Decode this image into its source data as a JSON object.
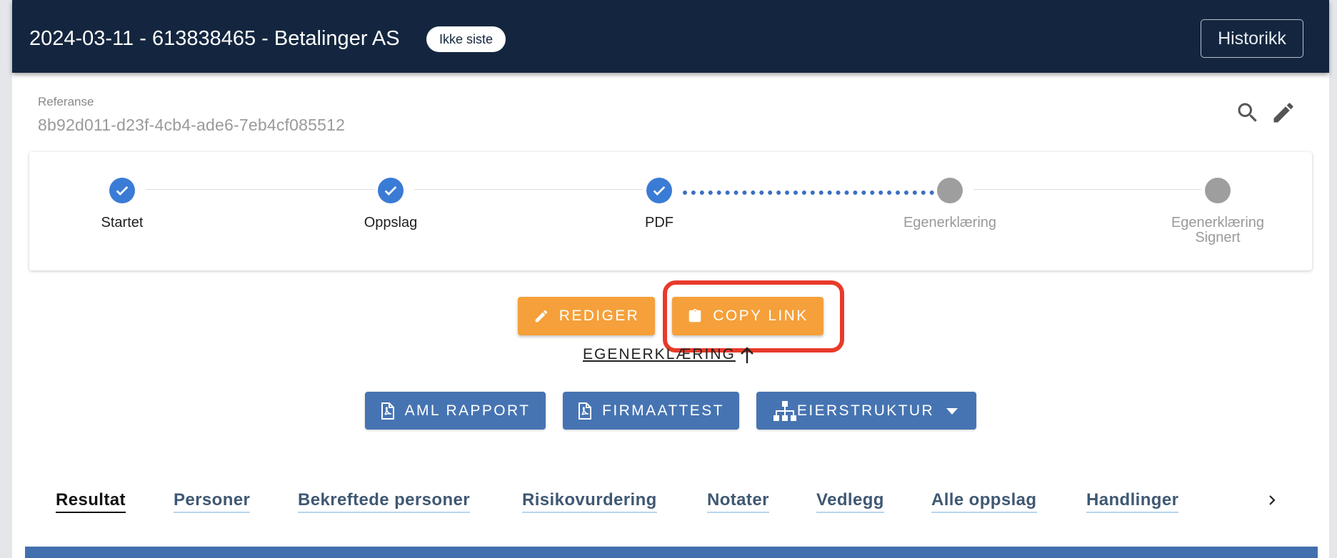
{
  "header": {
    "title": "2024-03-11 - 613838465 - Betalinger AS",
    "badge": "Ikke siste",
    "history_label": "Historikk",
    "background": "#14263f"
  },
  "reference": {
    "label": "Referanse",
    "value": "8b92d011-d23f-4cb4-ade6-7eb4cf085512"
  },
  "tools": {
    "search_icon": "search-icon",
    "edit_icon": "pencil-icon"
  },
  "stepper": {
    "steps": [
      {
        "label": "Startet",
        "status": "done"
      },
      {
        "label": "Oppslag",
        "status": "done"
      },
      {
        "label": "PDF",
        "status": "done"
      },
      {
        "label": "Egenerklæring",
        "status": "pending"
      },
      {
        "label": "Egenerklæring\nSignert",
        "status": "pending"
      }
    ],
    "done_color": "#3a7bd5",
    "pending_color": "#9e9e9e"
  },
  "actions": {
    "edit_label": "REDIGER",
    "copy_link_label": "COPY LINK",
    "self_declaration_link": "EGENERKLÆRING",
    "accent_color": "#f5a03a"
  },
  "documents": {
    "aml_report_label": "AML RAPPORT",
    "company_certificate_label": "FIRMAATTEST",
    "ownership_label": "EIERSTRUKTUR",
    "button_color": "#4674b2"
  },
  "tabs": [
    {
      "label": "Resultat",
      "active": true
    },
    {
      "label": "Personer",
      "active": false
    },
    {
      "label": "Bekreftede personer",
      "active": false
    },
    {
      "label": "Risikovurdering",
      "active": false
    },
    {
      "label": "Notater",
      "active": false
    },
    {
      "label": "Vedlegg",
      "active": false
    },
    {
      "label": "Alle oppslag",
      "active": false
    },
    {
      "label": "Handlinger",
      "active": false
    }
  ],
  "highlight_color": "#e83a2a"
}
